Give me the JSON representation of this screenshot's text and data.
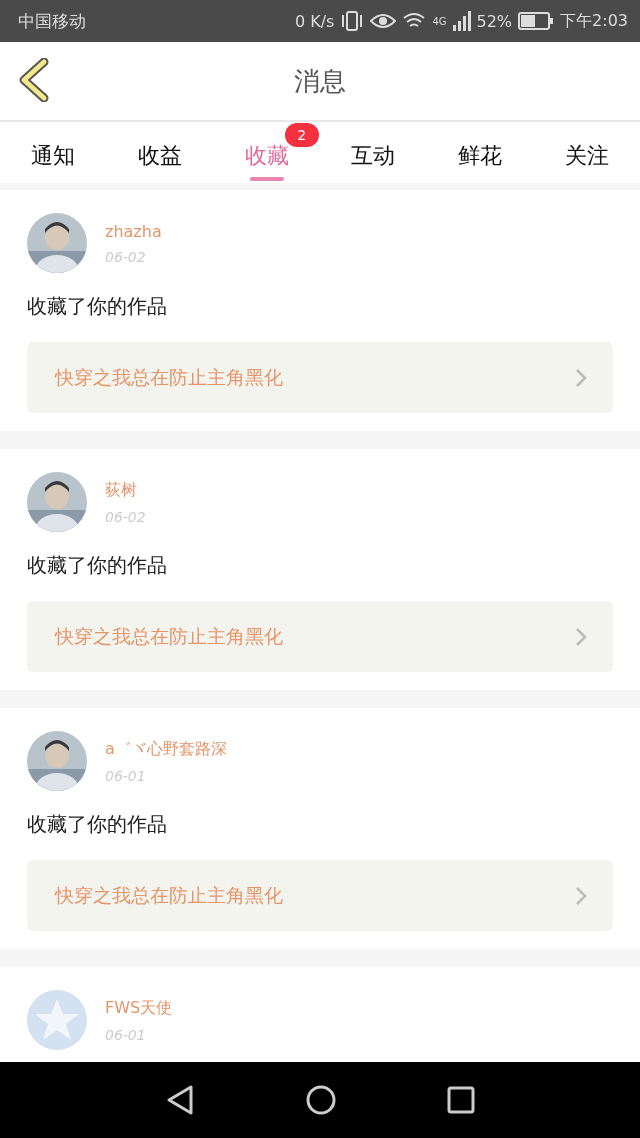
{
  "status_bar": {
    "carrier": "中国移动",
    "speed": "0 K/s",
    "network": "4G",
    "battery": "52%",
    "time": "下午2:03"
  },
  "header": {
    "title": "消息"
  },
  "tabs": [
    {
      "label": "通知",
      "selected": false
    },
    {
      "label": "收益",
      "selected": false
    },
    {
      "label": "收藏",
      "selected": true,
      "badge": "2"
    },
    {
      "label": "互动",
      "selected": false
    },
    {
      "label": "鲜花",
      "selected": false
    },
    {
      "label": "关注",
      "selected": false
    }
  ],
  "messages": [
    {
      "user": "zhazha",
      "date": "06-02",
      "action": "收藏了你的作品",
      "work": "快穿之我总在防止主角黑化"
    },
    {
      "user": "荻树",
      "date": "06-02",
      "action": "收藏了你的作品",
      "work": "快穿之我总在防止主角黑化"
    },
    {
      "user": "a゛ヾ心野套路深",
      "date": "06-01",
      "action": "收藏了你的作品",
      "work": "快穿之我总在防止主角黑化"
    },
    {
      "user": "FWS天使",
      "date": "06-01",
      "avatar": {
        "kind": "default"
      }
    }
  ]
}
